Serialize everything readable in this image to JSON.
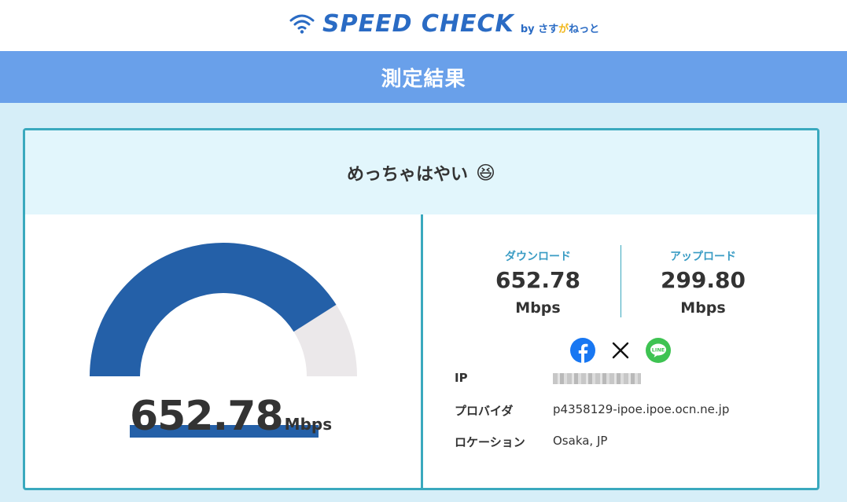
{
  "header": {
    "logo_text": "SPEED CHECK",
    "by_prefix": "by",
    "by_brand_a": "さす",
    "by_brand_b": "が",
    "by_brand_c": "ねっと"
  },
  "title": "測定結果",
  "result": {
    "verdict": "めっちゃはやい",
    "verdict_emoji": "😆",
    "gauge": {
      "value": "652.78",
      "unit": "Mbps",
      "fill_fraction": 0.82
    },
    "download": {
      "label": "ダウンロード",
      "value": "652.78",
      "unit": "Mbps"
    },
    "upload": {
      "label": "アップロード",
      "value": "299.80",
      "unit": "Mbps"
    },
    "share": {
      "icons": [
        "facebook-icon",
        "x-icon",
        "line-icon"
      ],
      "line_text": "LINE"
    },
    "info": {
      "ip_label": "IP",
      "provider_label": "プロバイダ",
      "provider_value": "p4358129-ipoe.ipoe.ocn.ne.jp",
      "location_label": "ロケーション",
      "location_value": "Osaka, JP"
    }
  },
  "colors": {
    "title_bar": "#69a0ea",
    "gauge_fill": "#2460a8",
    "gauge_track": "#ebe8ea",
    "accent": "#3aa9be",
    "stat_label": "#3a9cc4"
  }
}
